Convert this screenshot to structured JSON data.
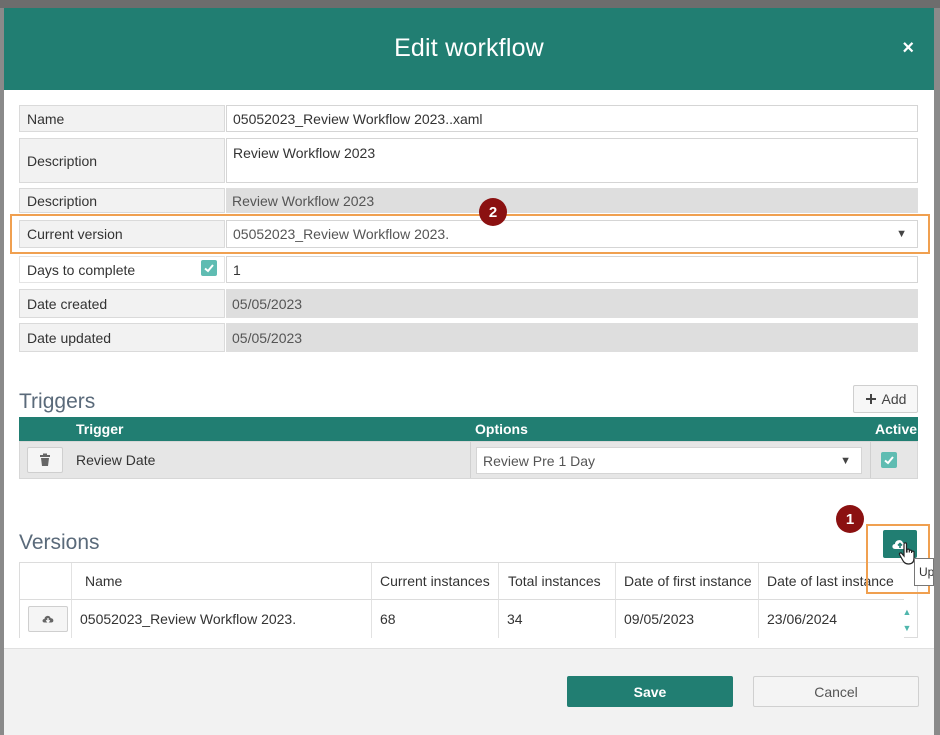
{
  "dialog": {
    "title": "Edit workflow",
    "close_label": "×"
  },
  "fields": {
    "name": {
      "label": "Name",
      "value": "05052023_Review Workflow 2023..xaml"
    },
    "description_edit": {
      "label": "Description",
      "value": "Review Workflow 2023"
    },
    "description_readonly": {
      "label": "Description",
      "value": "Review Workflow 2023"
    },
    "current_version": {
      "label": "Current version",
      "value": "05052023_Review Workflow 2023."
    },
    "days_to_complete": {
      "label": "Days to complete",
      "value": "1",
      "checked": true
    },
    "date_created": {
      "label": "Date created",
      "value": "05/05/2023"
    },
    "date_updated": {
      "label": "Date updated",
      "value": "05/05/2023"
    }
  },
  "triggers": {
    "title": "Triggers",
    "add_label": "Add",
    "columns": {
      "trigger": "Trigger",
      "options": "Options",
      "active": "Active"
    },
    "rows": [
      {
        "trigger": "Review Date",
        "option": "Review Pre 1 Day",
        "active": true
      }
    ]
  },
  "versions": {
    "title": "Versions",
    "columns": {
      "name": "Name",
      "current_instances": "Current instances",
      "total_instances": "Total instances",
      "date_first": "Date of first instance",
      "date_last": "Date of last instance"
    },
    "rows": [
      {
        "name": "05052023_Review Workflow 2023.",
        "current_instances": "68",
        "total_instances": "34",
        "date_first": "09/05/2023",
        "date_last": "23/06/2024"
      }
    ],
    "upload_tooltip": "Up"
  },
  "annotations": {
    "marker_1": "1",
    "marker_2": "2",
    "highlight_color": "#f0a050",
    "marker_color": "#8b1111"
  },
  "footer": {
    "save_label": "Save",
    "cancel_label": "Cancel"
  },
  "colors": {
    "header": "#217e72",
    "checkbox": "#5fbcb2"
  }
}
